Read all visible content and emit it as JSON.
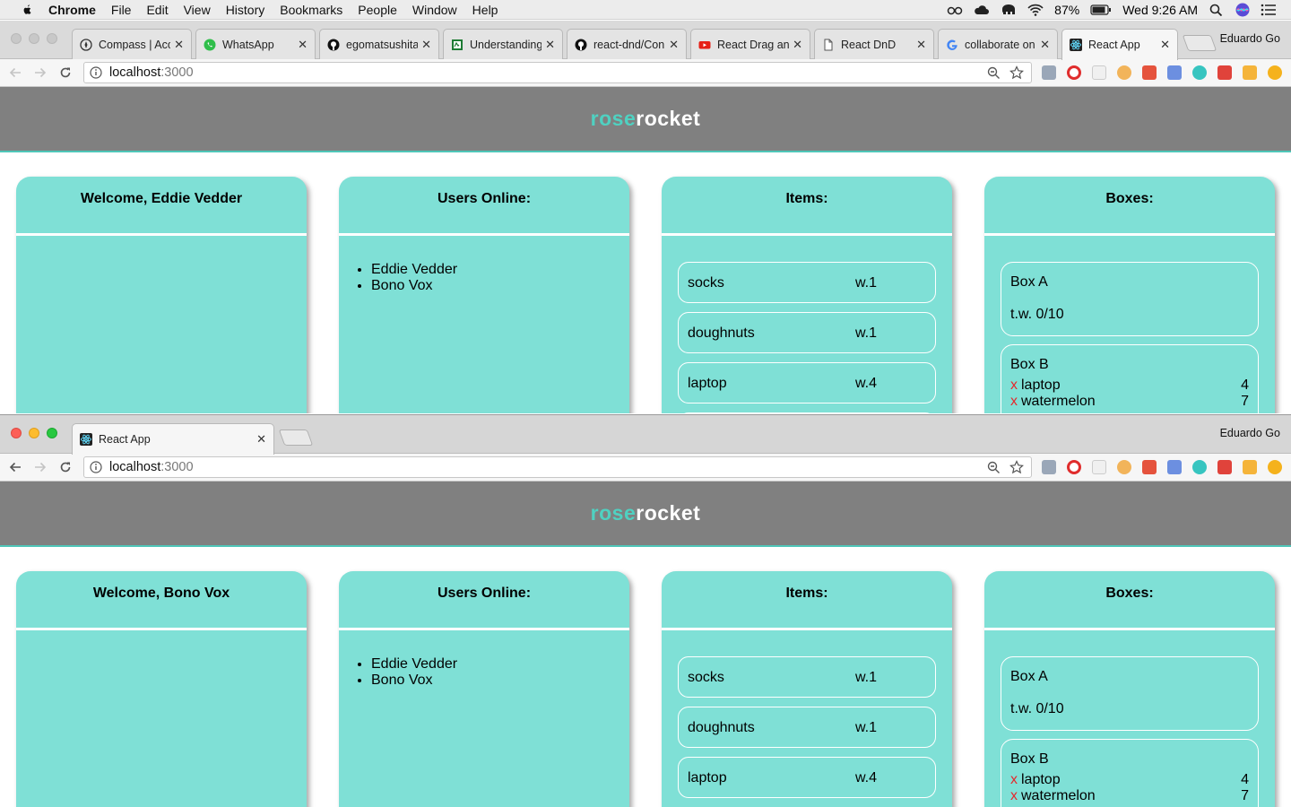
{
  "menubar": {
    "items": [
      "Chrome",
      "File",
      "Edit",
      "View",
      "History",
      "Bookmarks",
      "People",
      "Window",
      "Help"
    ],
    "battery": "87%",
    "clock": "Wed 9:26 AM"
  },
  "browser_top": {
    "tabs": [
      {
        "title": "Compass | Acc",
        "icon": "compass-icon"
      },
      {
        "title": "WhatsApp",
        "icon": "whatsapp-icon"
      },
      {
        "title": "egomatsushita",
        "icon": "github-icon"
      },
      {
        "title": "Understanding",
        "icon": "sheet-icon"
      },
      {
        "title": "react-dnd/Con",
        "icon": "github-icon"
      },
      {
        "title": "React Drag anc",
        "icon": "youtube-icon"
      },
      {
        "title": "React DnD",
        "icon": "document-icon"
      },
      {
        "title": "collaborate on",
        "icon": "google-icon"
      },
      {
        "title": "React App",
        "icon": "react-icon"
      }
    ],
    "profile": "Eduardo Go",
    "url_host": "localhost",
    "url_port": ":3000"
  },
  "browser_bottom": {
    "tabs": [
      {
        "title": "React App",
        "icon": "react-icon"
      }
    ],
    "profile": "Eduardo Go",
    "url_host": "localhost",
    "url_port": ":3000"
  },
  "brand": {
    "part1": "rose",
    "part2": "rocket"
  },
  "colors": {
    "panel": "#7fe0d6",
    "header": "#808080",
    "accent": "#4fd1c1",
    "remove": "#e5282d"
  },
  "app_top": {
    "welcome": "Welcome, Eddie Vedder",
    "users_title": "Users Online:",
    "users": [
      "Eddie Vedder",
      "Bono Vox"
    ],
    "items_title": "Items:",
    "items": [
      {
        "name": "socks",
        "weight": "w.1"
      },
      {
        "name": "doughnuts",
        "weight": "w.1"
      },
      {
        "name": "laptop",
        "weight": "w.4"
      }
    ],
    "boxes_title": "Boxes:",
    "box_a": {
      "name": "Box A",
      "tw": "t.w. 0/10"
    },
    "box_b": {
      "name": "Box B",
      "rows": [
        {
          "x": "x",
          "name": "laptop",
          "qty": "4"
        },
        {
          "x": "x",
          "name": "watermelon",
          "qty": "7"
        }
      ]
    }
  },
  "app_bottom": {
    "welcome": "Welcome, Bono Vox",
    "users_title": "Users Online:",
    "users": [
      "Eddie Vedder",
      "Bono Vox"
    ],
    "items_title": "Items:",
    "items": [
      {
        "name": "socks",
        "weight": "w.1"
      },
      {
        "name": "doughnuts",
        "weight": "w.1"
      },
      {
        "name": "laptop",
        "weight": "w.4"
      }
    ],
    "boxes_title": "Boxes:",
    "box_a": {
      "name": "Box A",
      "tw": "t.w. 0/10"
    },
    "box_b": {
      "name": "Box B",
      "rows": [
        {
          "x": "x",
          "name": "laptop",
          "qty": "4"
        },
        {
          "x": "x",
          "name": "watermelon",
          "qty": "7"
        }
      ]
    }
  }
}
